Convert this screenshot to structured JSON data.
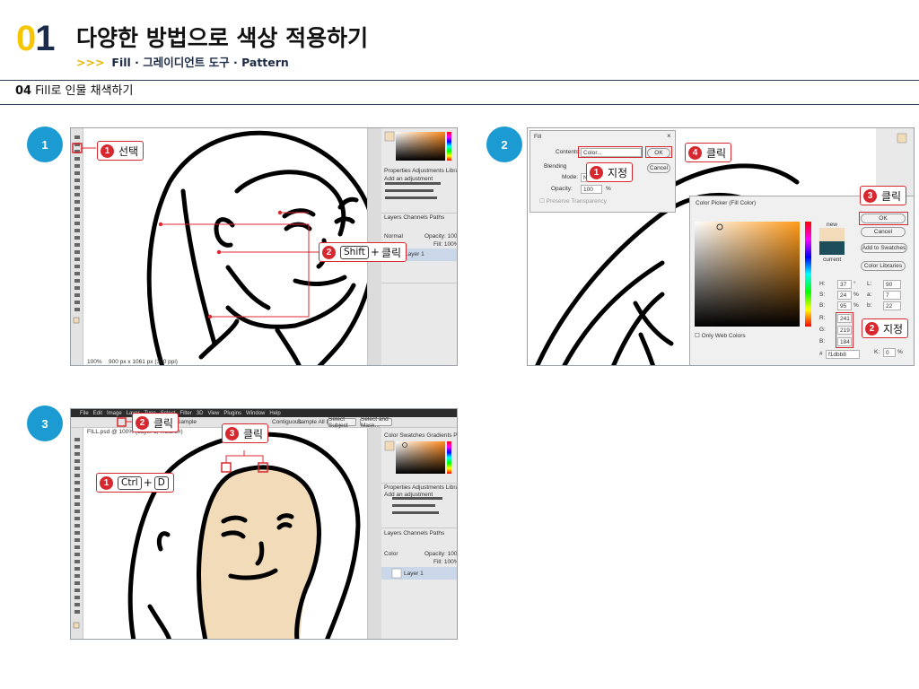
{
  "header": {
    "num_zero": "0",
    "num_one": "1",
    "title": "다양한 방법으로 색상 적용하기",
    "subtitle_arrows": ">>>",
    "subtitle": "Fill · 그레이디언트 도구 · Pattern"
  },
  "section": {
    "num": "04",
    "title": "Fill로 인물 채색하기"
  },
  "steps": [
    {
      "label": "1",
      "callouts": [
        {
          "badge": "1",
          "text": "선택"
        },
        {
          "badge": "2",
          "key": "Shift",
          "plus": "+",
          "text": "클릭"
        }
      ],
      "ps": {
        "zoom": "100%",
        "doc_info": "900 px x 1061 px (300 ppi)",
        "tabs": "Properties  Adjustments  Libraries",
        "adjust": "Add an adjustment",
        "layers_tabs": "Layers  Channels  Paths",
        "blend": "Normal",
        "opacity": "Opacity: 100%",
        "fill": "Fill: 100%",
        "layer": "Layer 1"
      }
    },
    {
      "label": "2",
      "callouts": [
        {
          "badge": "1",
          "text": "지정"
        },
        {
          "badge": "4",
          "text": "클릭"
        },
        {
          "badge": "3",
          "text": "클릭"
        },
        {
          "badge": "2",
          "text": "지정"
        }
      ],
      "fill_dialog": {
        "title": "Fill",
        "contents_label": "Contents:",
        "contents_value": "Color...",
        "blending": "Blending",
        "mode_label": "Mode:",
        "mode_value": "N",
        "opacity_label": "Opacity:",
        "opacity_value": "100",
        "opacity_unit": "%",
        "preserve": "Preserve Transparency",
        "ok": "OK",
        "cancel": "Cancel"
      },
      "color_picker": {
        "title": "Color Picker (Fill Color)",
        "new_label": "new",
        "current_label": "current",
        "ok": "OK",
        "cancel": "Cancel",
        "add_swatches": "Add to Swatches",
        "libraries": "Color Libraries",
        "only_web": "Only Web Colors",
        "h_label": "H:",
        "h": "37",
        "h_unit": "°",
        "s_label": "S:",
        "s": "24",
        "s_unit": "%",
        "b_label": "B:",
        "b": "95",
        "b_unit": "%",
        "r_label": "R:",
        "r": "241",
        "g_label": "G:",
        "g": "219",
        "b2_label": "B:",
        "b2": "184",
        "l_label": "L:",
        "l": "90",
        "a_label": "a:",
        "a": "7",
        "bb_label": "b:",
        "bb": "22",
        "k_label": "K:",
        "k": "0",
        "k_unit": "%",
        "hex_label": "#",
        "hex": "f1dbb8",
        "new_color": "#f1dbb8",
        "current_color": "#1d4e5a"
      }
    },
    {
      "label": "3",
      "callouts": [
        {
          "badge": "2",
          "text": "클릭"
        },
        {
          "badge": "3",
          "text": "클릭"
        },
        {
          "badge": "1",
          "key": "Ctrl",
          "plus": "+",
          "key2": "D"
        }
      ],
      "ps": {
        "menu": [
          "File",
          "Edit",
          "Image",
          "Layer",
          "Type",
          "Select",
          "Filter",
          "3D",
          "View",
          "Plugins",
          "Window",
          "Help"
        ],
        "doc_tab": "FILL.psd @ 100% (Layer 1, RGB/8#)",
        "sample": "Sample",
        "contiguous": "Contiguous",
        "sample_all": "Sample All Layers",
        "select_subject": "Select Subject",
        "select_mask": "Select and Mask...",
        "color_tabs": "Color  Swatches  Gradients  Patterns",
        "tabs": "Properties  Adjustments  Libraries",
        "adjust": "Add an adjustment",
        "layers_tabs": "Layers  Channels  Paths",
        "blend": "Color",
        "opacity": "Opacity: 100%",
        "fill": "Fill: 100%",
        "layer": "Layer 1"
      }
    }
  ],
  "colors": {
    "accent_red": "#d8282f",
    "step_blue": "#1b9bd2",
    "skin": "#f1dbb8",
    "navy": "#1a2a4a",
    "yellow": "#f6c600"
  }
}
